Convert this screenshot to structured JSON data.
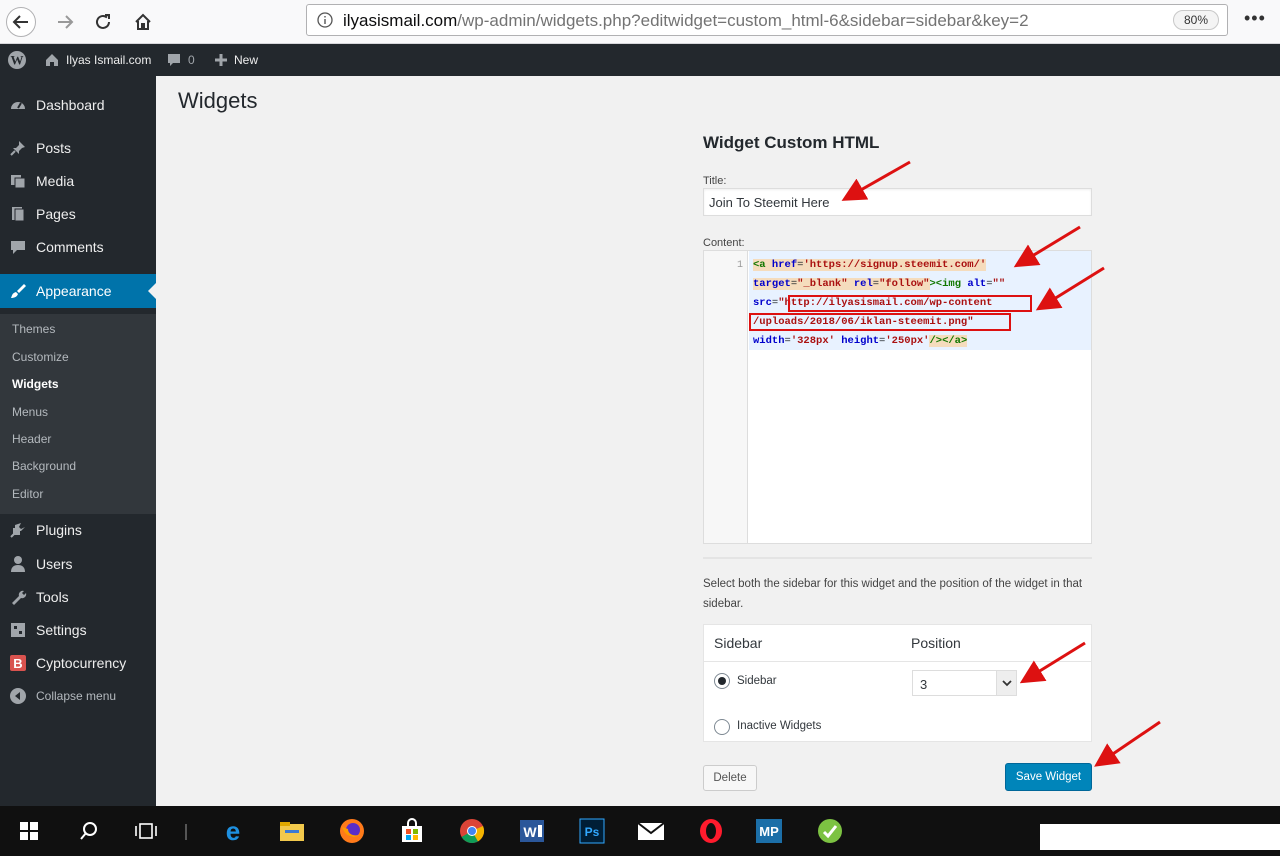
{
  "browser": {
    "url_host": "ilyasismail.com",
    "url_path": "/wp-admin/widgets.php?editwidget=custom_html-6&sidebar=sidebar&key=2",
    "zoom": "80%"
  },
  "adminbar": {
    "site_name": "Ilyas Ismail.com",
    "comments_count": "0",
    "new_label": "New"
  },
  "sidebar": {
    "items": [
      {
        "label": "Dashboard",
        "icon": "dashboard-icon"
      },
      {
        "label": "Posts",
        "icon": "pin-icon"
      },
      {
        "label": "Media",
        "icon": "media-icon"
      },
      {
        "label": "Pages",
        "icon": "pages-icon"
      },
      {
        "label": "Comments",
        "icon": "comment-icon"
      },
      {
        "label": "Appearance",
        "icon": "paintbrush-icon"
      },
      {
        "label": "Plugins",
        "icon": "plugin-icon"
      },
      {
        "label": "Users",
        "icon": "user-icon"
      },
      {
        "label": "Tools",
        "icon": "wrench-icon"
      },
      {
        "label": "Settings",
        "icon": "settings-icon"
      },
      {
        "label": "Cyptocurrency",
        "icon": "bitcoin-icon"
      }
    ],
    "submenu": [
      "Themes",
      "Customize",
      "Widgets",
      "Menus",
      "Header",
      "Background",
      "Editor"
    ],
    "collapse_label": "Collapse menu"
  },
  "main": {
    "page_title": "Widgets",
    "widget_heading": "Widget Custom HTML",
    "title_label": "Title:",
    "title_value": "Join To Steemit Here",
    "content_label": "Content:",
    "line_number": "1",
    "code": {
      "l1_tag_open": "<a",
      "l1_attr": " href",
      "l1_eq": "=",
      "l1_str": "'https://signup.steemit.com/'",
      "l2_attr": "target",
      "l2_eq": "=",
      "l2_str": "\"_blank\"",
      "l2_attr2": " rel",
      "l2_eq2": "=",
      "l2_str2": "\"follow\"",
      "l2_tag": "><img",
      "l2_attr3": " alt",
      "l2_eq3": "=",
      "l2_str3": "\"\"",
      "l3_attr": "src",
      "l3_eq": "=",
      "l3_str": "\"http://ilyasismail.com/wp-content",
      "l4_str": "/uploads/2018/06/iklan-steemit.png\"",
      "l5_attr": "width",
      "l5_eq": "=",
      "l5_str": "'328px'",
      "l5_attr2": " height",
      "l5_eq2": "=",
      "l5_str2": "'250px'",
      "l5_tag": "/></a>"
    },
    "help_text": "Select both the sidebar for this widget and the position of the widget in that sidebar.",
    "table": {
      "col_sidebar": "Sidebar",
      "col_position": "Position",
      "option_sidebar": "Sidebar",
      "option_inactive": "Inactive Widgets",
      "position_value": "3"
    },
    "delete_label": "Delete",
    "save_label": "Save Widget"
  },
  "colors": {
    "accent": "#0073aa",
    "button_primary": "#0085ba",
    "annotation_red": "#d11"
  }
}
